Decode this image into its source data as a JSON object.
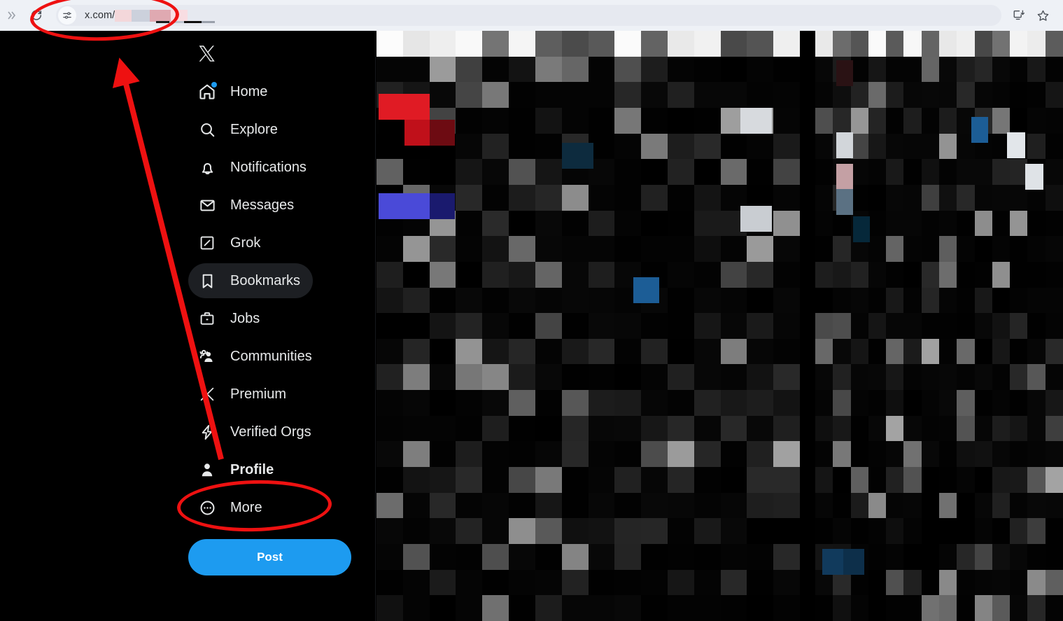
{
  "browser": {
    "overflow_icon": "chevrons-right-icon",
    "reload_icon": "reload-icon",
    "site_settings_icon": "site-settings-sliders-icon",
    "url_prefix": "x.com/",
    "url_redacted": true,
    "actions": [
      {
        "name": "install-app-icon",
        "label": "Install"
      },
      {
        "name": "bookmark-star-icon",
        "label": "Bookmark this tab"
      }
    ]
  },
  "sidebar": {
    "logo": "x-logo",
    "items": [
      {
        "label": "Home",
        "icon": "home-icon",
        "active": false,
        "badge": true,
        "bold": false
      },
      {
        "label": "Explore",
        "icon": "search-icon",
        "active": false,
        "badge": false,
        "bold": false
      },
      {
        "label": "Notifications",
        "icon": "bell-icon",
        "active": false,
        "badge": false,
        "bold": false
      },
      {
        "label": "Messages",
        "icon": "envelope-icon",
        "active": false,
        "badge": false,
        "bold": false
      },
      {
        "label": "Grok",
        "icon": "grok-icon",
        "active": false,
        "badge": false,
        "bold": false
      },
      {
        "label": "Bookmarks",
        "icon": "bookmark-icon",
        "active": true,
        "badge": false,
        "bold": false
      },
      {
        "label": "Jobs",
        "icon": "briefcase-icon",
        "active": false,
        "badge": false,
        "bold": false
      },
      {
        "label": "Communities",
        "icon": "communities-icon",
        "active": false,
        "badge": false,
        "bold": false
      },
      {
        "label": "Premium",
        "icon": "x-logo-icon",
        "active": false,
        "badge": false,
        "bold": false
      },
      {
        "label": "Verified Orgs",
        "icon": "bolt-icon",
        "active": false,
        "badge": false,
        "bold": false
      },
      {
        "label": "Profile",
        "icon": "person-icon",
        "active": false,
        "badge": false,
        "bold": true
      },
      {
        "label": "More",
        "icon": "more-circle-icon",
        "active": false,
        "badge": false,
        "bold": false
      }
    ],
    "post_button_label": "Post"
  },
  "content": {
    "main_column_state": "pixelated-redacted",
    "right_column_state": "pixelated-redacted"
  },
  "annotations": {
    "color": "#ee1111",
    "shapes": [
      {
        "name": "url-highlight-ellipse",
        "type": "ellipse",
        "target": "address-bar"
      },
      {
        "name": "profile-highlight-ellipse",
        "type": "ellipse",
        "target": "sidebar-item-profile"
      },
      {
        "name": "profile-to-url-arrow",
        "type": "arrow",
        "from": "sidebar-item-verified-orgs",
        "to": "address-bar"
      }
    ]
  },
  "colors": {
    "accent_blue": "#1d9bf0",
    "annotation_red": "#ee1111",
    "page_background": "#000000",
    "chrome_background": "#eef1f6",
    "text_primary": "#e7e9ea"
  }
}
